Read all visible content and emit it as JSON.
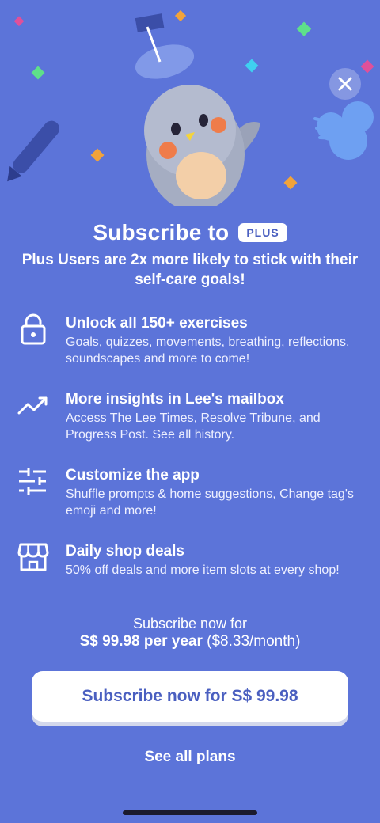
{
  "header": {
    "title": "Subscribe to",
    "badge": "PLUS",
    "subtitle": "Plus Users are 2x more likely to stick with their self-care goals!"
  },
  "features": [
    {
      "icon": "lock-icon",
      "title": "Unlock all 150+ exercises",
      "desc": "Goals, quizzes, movements, breathing, reflections, soundscapes and more to come!"
    },
    {
      "icon": "trending-up-icon",
      "title": "More insights in Lee's mailbox",
      "desc": "Access The Lee Times, Resolve Tribune, and Progress Post. See all history."
    },
    {
      "icon": "sliders-icon",
      "title": "Customize the app",
      "desc": "Shuffle prompts & home suggestions, Change tag's emoji and more!"
    },
    {
      "icon": "shop-icon",
      "title": "Daily shop deals",
      "desc": "50% off deals and more item slots at every shop!"
    }
  ],
  "pricing": {
    "line1": "Subscribe now for",
    "price_bold": "S$ 99.98 per year",
    "price_monthly": "($8.33/month)"
  },
  "cta": {
    "label": "Subscribe now for S$ 99.98"
  },
  "secondary": {
    "label": "See all plans"
  },
  "colors": {
    "background": "#5c74d9",
    "accent": "#4a5fc0",
    "button_bg": "#ffffff"
  }
}
